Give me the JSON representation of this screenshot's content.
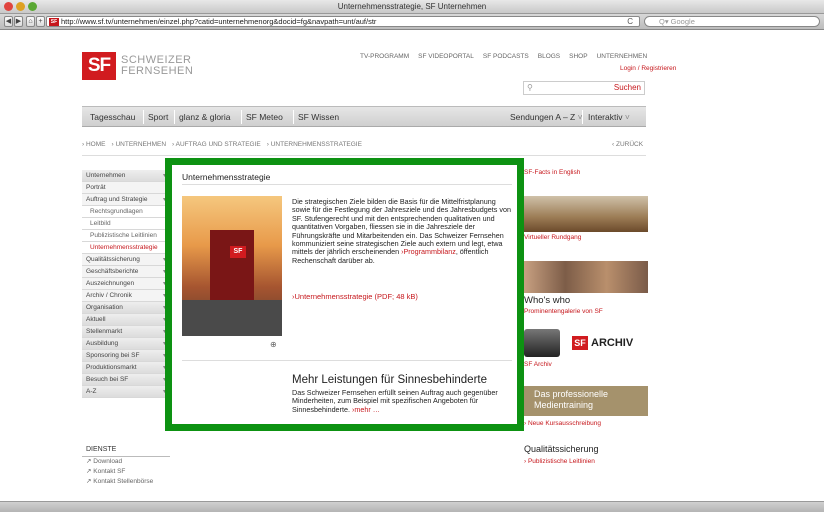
{
  "browser": {
    "window_title": "Unternehmensstrategie, SF Unternehmen",
    "url": "http://www.sf.tv/unternehmen/einzel.php?catid=unternehmenorg&docid=fg&navpath=unt/auf/str",
    "favicon_text": "SF",
    "search_placeholder": "Q▾ Google",
    "back": "◀",
    "forward": "▶",
    "home": "⌂",
    "add": "+",
    "reload": "C"
  },
  "header": {
    "logo_mark": "SF",
    "logo_line1": "SCHWEIZER",
    "logo_line2": "FERNSEHEN",
    "top_links": [
      "TV-PROGRAMM",
      "SF VIDEOPORTAL",
      "SF PODCASTS",
      "BLOGS",
      "SHOP",
      "UNTERNEHMEN"
    ],
    "login": "Login / Registrieren",
    "search_button": "Suchen"
  },
  "main_nav": {
    "items": [
      "Tagesschau",
      "Sport",
      "glanz & gloria",
      "SF Meteo",
      "SF Wissen"
    ],
    "right_items": [
      "Sendungen A – Z",
      "Interaktiv"
    ]
  },
  "breadcrumb": {
    "items": [
      "› HOME",
      "› UNTERNEHMEN",
      "› AUFTRAG UND STRATEGIE",
      "› UNTERNEHMENSSTRATEGIE"
    ],
    "back": "‹ ZURÜCK"
  },
  "left_nav": {
    "items": [
      {
        "label": "Unternehmen",
        "level": 1,
        "chev": true
      },
      {
        "label": "Porträt",
        "level": 2,
        "chev": false
      },
      {
        "label": "Auftrag und Strategie",
        "level": 2,
        "chev": true
      },
      {
        "label": "Rechtsgrundlagen",
        "level": 3,
        "chev": false
      },
      {
        "label": "Leitbild",
        "level": 3,
        "chev": false
      },
      {
        "label": "Publizistische Leitlinien",
        "level": 3,
        "chev": false
      },
      {
        "label": "Unternehmensstrategie",
        "level": 3,
        "chev": false,
        "active": true
      },
      {
        "label": "Qualitätssicherung",
        "level": 2,
        "chev": true
      },
      {
        "label": "Geschäftsberichte",
        "level": 2,
        "chev": true
      },
      {
        "label": "Auszeichnungen",
        "level": 2,
        "chev": true
      },
      {
        "label": "Archiv / Chronik",
        "level": 2,
        "chev": true
      },
      {
        "label": "Organisation",
        "level": 1,
        "chev": true
      },
      {
        "label": "Aktuell",
        "level": 1,
        "chev": true
      },
      {
        "label": "Stellenmarkt",
        "level": 1,
        "chev": true
      },
      {
        "label": "Ausbildung",
        "level": 1,
        "chev": true
      },
      {
        "label": "Sponsoring bei SF",
        "level": 1,
        "chev": true
      },
      {
        "label": "Produktionsmarkt",
        "level": 1,
        "chev": true
      },
      {
        "label": "Besuch bei SF",
        "level": 1,
        "chev": true
      },
      {
        "label": "A-Z",
        "level": 1,
        "chev": true
      }
    ]
  },
  "dienste": {
    "title": "DIENSTE",
    "items": [
      "↗ Download",
      "↗ Kontakt SF",
      "↗ Kontakt Stellenbörse"
    ]
  },
  "article": {
    "heading": "Unternehmensstrategie",
    "body": "Die strategischen Ziele bilden die Basis für die Mittelfristplanung sowie für die Festlegung der Jahresziele und des Jahresbudgets von SF. Stufengerecht und mit den entsprechenden qualitativen und quantitativen Vorgaben, fliessen sie in die Jahresziele der Führungskräfte und Mitarbeitenden ein. Das Schweizer Fernsehen kommuniziert seine strategischen Ziele auch extern und legt, etwa mittels der jährlich erscheinenden",
    "body_link": "›Programmbilanz",
    "body_tail": ", öffentlich Rechenschaft darüber ab.",
    "pdf_link": "›Unternehmensstrategie (PDF; 48 kB)",
    "zoom_icon": "⊕",
    "photo_mark": "SF",
    "section2_title": "Mehr Leistungen für Sinnesbehinderte",
    "section2_body": "Das Schweizer Fernsehen erfüllt seinen Auftrag auch gegenüber Minderheiten, zum Beispiel mit spezifischen Angeboten für Sinnesbehinderte.",
    "section2_more": "›mehr …"
  },
  "right_col": {
    "facts_link": "SF-Facts in English",
    "tour_link": "Virtueller Rundgang",
    "whoswho_title": "Who's who",
    "whoswho_link": "Prominentengalerie von SF",
    "archiv_mark": "SF",
    "archiv_word": "ARCHIV",
    "archiv_link": "SF Archiv",
    "training_line1": "Das professionelle",
    "training_line2": "Medientraining",
    "training_link": "› Neue Kursausschreibung",
    "qs_title": "Qualitätssicherung",
    "qs_link": "› Publizistische Leitlinien"
  },
  "colors": {
    "brand_red": "#d11b1f",
    "highlight_green": "#0d9212",
    "link_red": "#c6171c"
  }
}
